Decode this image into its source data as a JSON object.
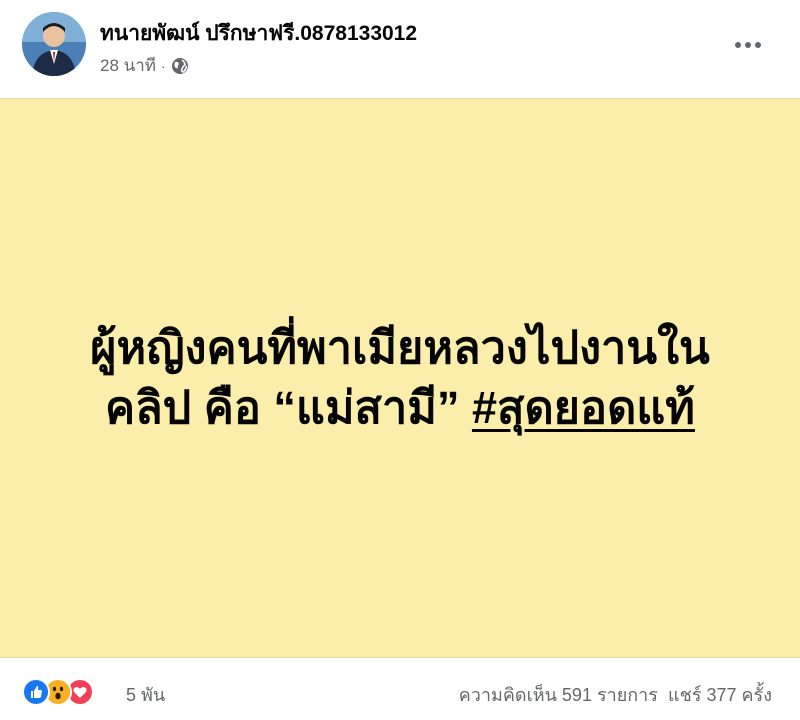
{
  "post": {
    "author_name": "ทนายพัฒน์ ปรึกษาฟรี.0878133012",
    "timestamp": "28 นาที",
    "separator": "·",
    "privacy_icon": "globe-icon",
    "more_icon": "more-horizontal-icon"
  },
  "card": {
    "background_color": "#fbeeab",
    "line1": "ผู้หญิงคนที่พาเมียหลวงไปงานใน",
    "line2_prefix": "คลิป คือ “แม่สามี” ",
    "hashtag": "#สุดยอดแท้"
  },
  "footer": {
    "reaction_icons": [
      "like-icon",
      "wow-icon",
      "love-icon"
    ],
    "reaction_count": "5 พัน",
    "comments": "ความคิดเห็น 591 รายการ",
    "shares": "แชร์ 377 ครั้ง"
  },
  "colors": {
    "like": "#1877f2",
    "wow": "#f7b125",
    "love": "#f33e58"
  }
}
